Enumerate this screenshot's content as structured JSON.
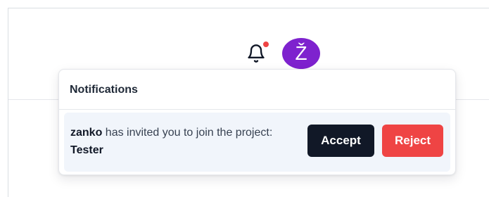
{
  "header": {
    "notifications_icon": "bell-icon",
    "unread_indicator_color": "#ef4444",
    "avatar_initial": "Ž",
    "avatar_color": "#7e22ce"
  },
  "notifications_panel": {
    "title": "Notifications",
    "items": [
      {
        "user": "zanko",
        "message_middle": " has invited you to join the project: ",
        "project": "Tester",
        "accept_label": "Accept",
        "reject_label": "Reject",
        "accept_color": "#111827",
        "reject_color": "#ef4444"
      }
    ]
  }
}
